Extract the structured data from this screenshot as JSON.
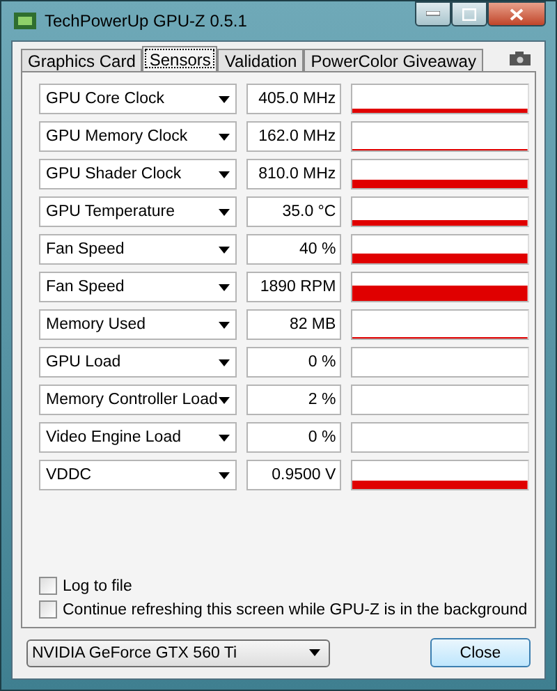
{
  "window": {
    "title": "TechPowerUp GPU-Z 0.5.1"
  },
  "tabs": [
    {
      "label": "Graphics Card",
      "selected": false
    },
    {
      "label": "Sensors",
      "selected": true
    },
    {
      "label": "Validation",
      "selected": false
    },
    {
      "label": "PowerColor Giveaway",
      "selected": false
    }
  ],
  "sensors": [
    {
      "name": "GPU Core Clock",
      "value": "405.0 MHz"
    },
    {
      "name": "GPU Memory Clock",
      "value": "162.0 MHz"
    },
    {
      "name": "GPU Shader Clock",
      "value": "810.0 MHz"
    },
    {
      "name": "GPU Temperature",
      "value": "35.0 °C"
    },
    {
      "name": "Fan Speed",
      "value": "40 %"
    },
    {
      "name": "Fan Speed",
      "value": "1890 RPM"
    },
    {
      "name": "Memory Used",
      "value": "82 MB"
    },
    {
      "name": "GPU Load",
      "value": "0 %"
    },
    {
      "name": "Memory Controller Load",
      "value": "2 %"
    },
    {
      "name": "Video Engine Load",
      "value": "0 %"
    },
    {
      "name": "VDDC",
      "value": "0.9500 V"
    }
  ],
  "options": [
    {
      "label": "Log to file",
      "checked": false
    },
    {
      "label": "Continue refreshing this screen while GPU-Z is in the background",
      "checked": false
    }
  ],
  "gpu_select": {
    "value": "NVIDIA GeForce GTX 560 Ti"
  },
  "close_button": {
    "label": "Close"
  }
}
